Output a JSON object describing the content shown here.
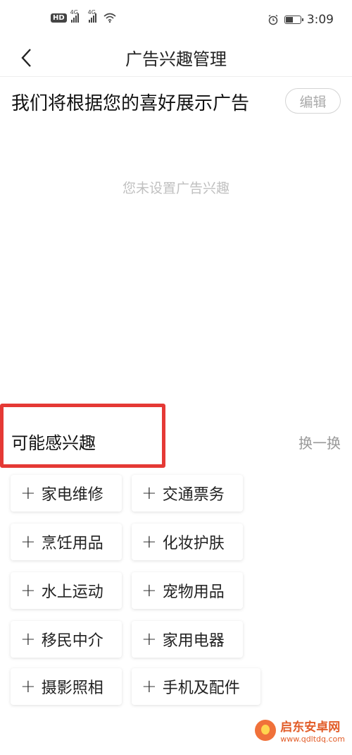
{
  "status_bar": {
    "hd_badge": "HD",
    "signal_1_tag": "4G",
    "signal_2_tag": "4G",
    "time": "3:09",
    "battery_level": 0.45,
    "icons": [
      "hd-icon",
      "signal-icon",
      "signal-icon",
      "wifi-icon",
      "alarm-icon",
      "battery-icon"
    ]
  },
  "navbar": {
    "title": "广告兴趣管理",
    "back_icon": "chevron-left-icon"
  },
  "intro": {
    "text": "我们将根据您的喜好展示广告",
    "edit_label": "编辑"
  },
  "empty_state": {
    "text": "您未设置广告兴趣"
  },
  "suggestions": {
    "title": "可能感兴趣",
    "refresh_label": "换一换",
    "highlight_color": "#e53935",
    "tags": [
      {
        "label": "家电维修"
      },
      {
        "label": "交通票务"
      },
      {
        "label": "烹饪用品"
      },
      {
        "label": "化妆护肤"
      },
      {
        "label": "水上运动"
      },
      {
        "label": "宠物用品"
      },
      {
        "label": "移民中介"
      },
      {
        "label": "家用电器"
      },
      {
        "label": "摄影照相"
      },
      {
        "label": "手机及配件"
      }
    ]
  },
  "watermark": {
    "title": "启东安卓网",
    "url": "www.qdltdq.com"
  }
}
